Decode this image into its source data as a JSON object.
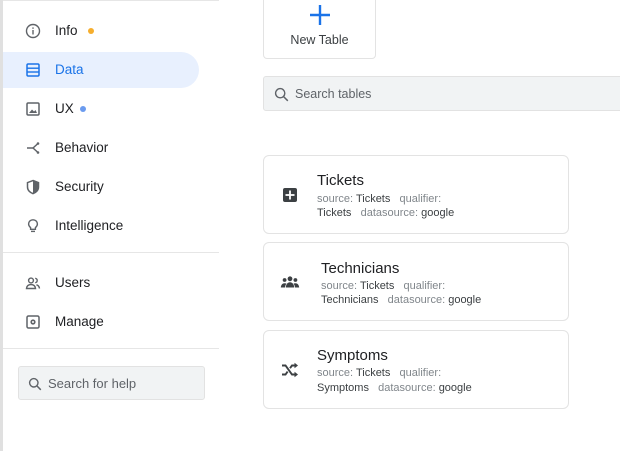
{
  "sidebar": {
    "items": [
      {
        "label": "Info",
        "icon": "info-circle-icon",
        "dot_color": "#f6ae2d"
      },
      {
        "label": "Data",
        "icon": "table-rows-icon",
        "active": true
      },
      {
        "label": "UX",
        "icon": "image-frame-icon",
        "dot_color": "#6b9bef"
      },
      {
        "label": "Behavior",
        "icon": "branch-icon"
      },
      {
        "label": "Security",
        "icon": "shield-icon"
      },
      {
        "label": "Intelligence",
        "icon": "lightbulb-icon"
      },
      {
        "label": "Users",
        "icon": "users-icon"
      },
      {
        "label": "Manage",
        "icon": "manage-gear-icon"
      }
    ],
    "help_placeholder": "Search for help"
  },
  "main": {
    "new_table_label": "New Table",
    "search_placeholder": "Search tables",
    "accent_color": "#1a73e8",
    "tables": [
      {
        "title": "Tickets",
        "icon": "plus-box-icon",
        "source_label": "source:",
        "source": "Tickets",
        "qualifier_label": "qualifier:",
        "qualifier": "Tickets",
        "datasource_label": "datasource:",
        "datasource": "google"
      },
      {
        "title": "Technicians",
        "icon": "group-icon",
        "source_label": "source:",
        "source": "Tickets",
        "qualifier_label": "qualifier:",
        "qualifier": "Technicians",
        "datasource_label": "datasource:",
        "datasource": "google"
      },
      {
        "title": "Symptoms",
        "icon": "shuffle-icon",
        "source_label": "source:",
        "source": "Tickets",
        "qualifier_label": "qualifier:",
        "qualifier": "Symptoms",
        "datasource_label": "datasource:",
        "datasource": "google"
      }
    ]
  }
}
